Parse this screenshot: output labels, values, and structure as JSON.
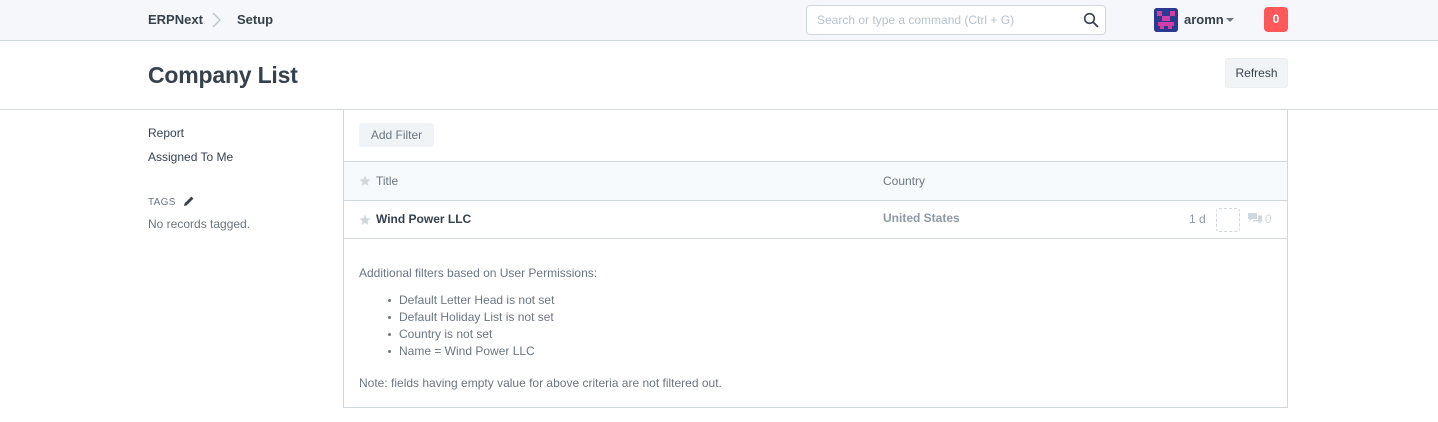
{
  "navbar": {
    "brand": "ERPNext",
    "breadcrumb": "Setup",
    "search_placeholder": "Search or type a command (Ctrl + G)",
    "user_name": "aromn",
    "notification_count": "0",
    "notification_color": "#ff5858"
  },
  "page": {
    "title": "Company List",
    "refresh_label": "Refresh"
  },
  "sidebar": {
    "links": [
      "Report",
      "Assigned To Me"
    ],
    "tags_label": "TAGS",
    "no_tags": "No records tagged."
  },
  "list": {
    "add_filter_label": "Add Filter",
    "columns": [
      "Title",
      "Country"
    ],
    "rows": [
      {
        "title": "Wind Power LLC",
        "country": "United States",
        "modified": "1 d",
        "comments": "0"
      }
    ]
  },
  "permissions": {
    "intro": "Additional filters based on User Permissions:",
    "items": [
      "Default Letter Head is not set",
      "Default Holiday List is not set",
      "Country is not set",
      "Name = Wind Power LLC"
    ],
    "note": "Note: fields having empty value for above criteria are not filtered out."
  },
  "icons": {
    "breadcrumb_separator": "chevron-right-icon",
    "search": "search-icon",
    "user_menu": "caret-down-icon",
    "tag_edit": "pencil-icon",
    "favorite": "star-icon",
    "comments": "comment-icon"
  }
}
